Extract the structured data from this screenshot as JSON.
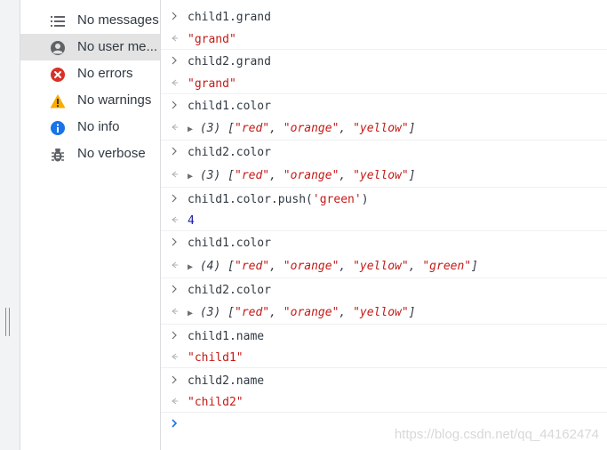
{
  "sidebar": {
    "items": [
      {
        "label": "No messages",
        "icon": "list-icon"
      },
      {
        "label": "No user me...",
        "icon": "user-icon"
      },
      {
        "label": "No errors",
        "icon": "error-icon"
      },
      {
        "label": "No warnings",
        "icon": "warning-icon"
      },
      {
        "label": "No info",
        "icon": "info-icon"
      },
      {
        "label": "No verbose",
        "icon": "bug-icon"
      }
    ],
    "selected_index": 1
  },
  "console": {
    "entries": [
      {
        "input": "child1.grand",
        "output": "\"grand\""
      },
      {
        "input": "child2.grand",
        "output": "\"grand\""
      },
      {
        "input": "child1.color",
        "output_count": "(3)",
        "output_items": [
          "\"red\"",
          "\"orange\"",
          "\"yellow\""
        ]
      },
      {
        "input": "child2.color",
        "output_count": "(3)",
        "output_items": [
          "\"red\"",
          "\"orange\"",
          "\"yellow\""
        ]
      },
      {
        "input_prefix": "child1.color.push(",
        "input_arg": "'green'",
        "input_suffix": ")",
        "output": "4"
      },
      {
        "input": "child1.color",
        "output_count": "(4)",
        "output_items": [
          "\"red\"",
          "\"orange\"",
          "\"yellow\"",
          "\"green\""
        ]
      },
      {
        "input": "child2.color",
        "output_count": "(3)",
        "output_items": [
          "\"red\"",
          "\"orange\"",
          "\"yellow\""
        ]
      },
      {
        "input": "child1.name",
        "output": "\"child1\""
      },
      {
        "input": "child2.name",
        "output": "\"child2\""
      }
    ]
  },
  "watermark": "https://blog.csdn.net/qq_44162474",
  "colors": {
    "string": "#c41a16",
    "number": "#1a1aa6",
    "prompt": "#1a73e8",
    "error": "#d93025",
    "warning": "#f9ab00",
    "info": "#1a73e8"
  }
}
